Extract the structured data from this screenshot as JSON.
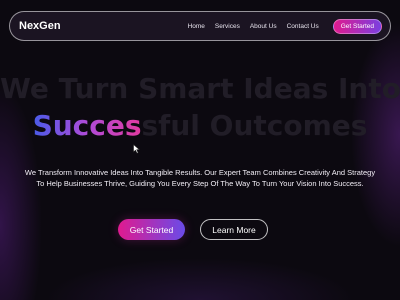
{
  "nav": {
    "logo": "NexGen",
    "links": [
      "Home",
      "Services",
      "About Us",
      "Contact Us"
    ],
    "cta_label": "Get Started"
  },
  "hero": {
    "title_line1": "We Turn Smart Ideas Into",
    "title_line2_highlight": "Succes",
    "title_line2_rest": "sful Outcomes",
    "description_lines": [
      "We Transform Innovative Ideas Into Tangible Results. Our Expert Team Combines Creativity And Strategy",
      "To Help Businesses Thrive, Guiding You Every Step Of The Way To Turn Your Vision Into Success."
    ],
    "primary_button": "Get Started",
    "secondary_button": "Learn More"
  },
  "colors": {
    "background": "#0c0910",
    "accent_pink": "#e01a8f",
    "accent_purple": "#6a4be8",
    "title_dim": "#211d27"
  },
  "icons": {
    "cursor": "mouse-pointer-icon"
  }
}
